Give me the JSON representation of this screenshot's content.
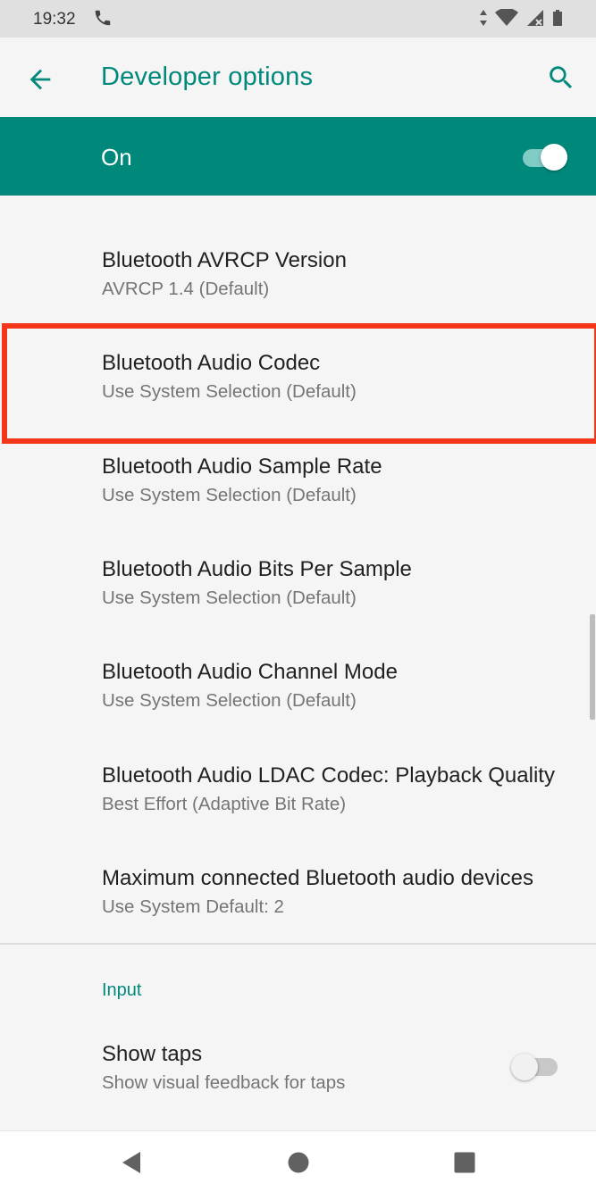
{
  "status": {
    "time": "19:32"
  },
  "appbar": {
    "title": "Developer options"
  },
  "master": {
    "label": "On",
    "enabled": true
  },
  "prefs": [
    {
      "title": "Bluetooth AVRCP Version",
      "summary": "AVRCP 1.4 (Default)"
    },
    {
      "title": "Bluetooth Audio Codec",
      "summary": "Use System Selection (Default)"
    },
    {
      "title": "Bluetooth Audio Sample Rate",
      "summary": "Use System Selection (Default)"
    },
    {
      "title": "Bluetooth Audio Bits Per Sample",
      "summary": "Use System Selection (Default)"
    },
    {
      "title": "Bluetooth Audio Channel Mode",
      "summary": "Use System Selection (Default)"
    },
    {
      "title": "Bluetooth Audio LDAC Codec: Playback Quality",
      "summary": "Best Effort (Adaptive Bit Rate)"
    },
    {
      "title": "Maximum connected Bluetooth audio devices",
      "summary": "Use System Default: 2"
    }
  ],
  "section_input": {
    "header": "Input"
  },
  "show_taps": {
    "title": "Show taps",
    "summary": "Show visual feedback for taps",
    "enabled": false
  },
  "colors": {
    "accent": "#00897b",
    "highlight": "#f4361a"
  }
}
